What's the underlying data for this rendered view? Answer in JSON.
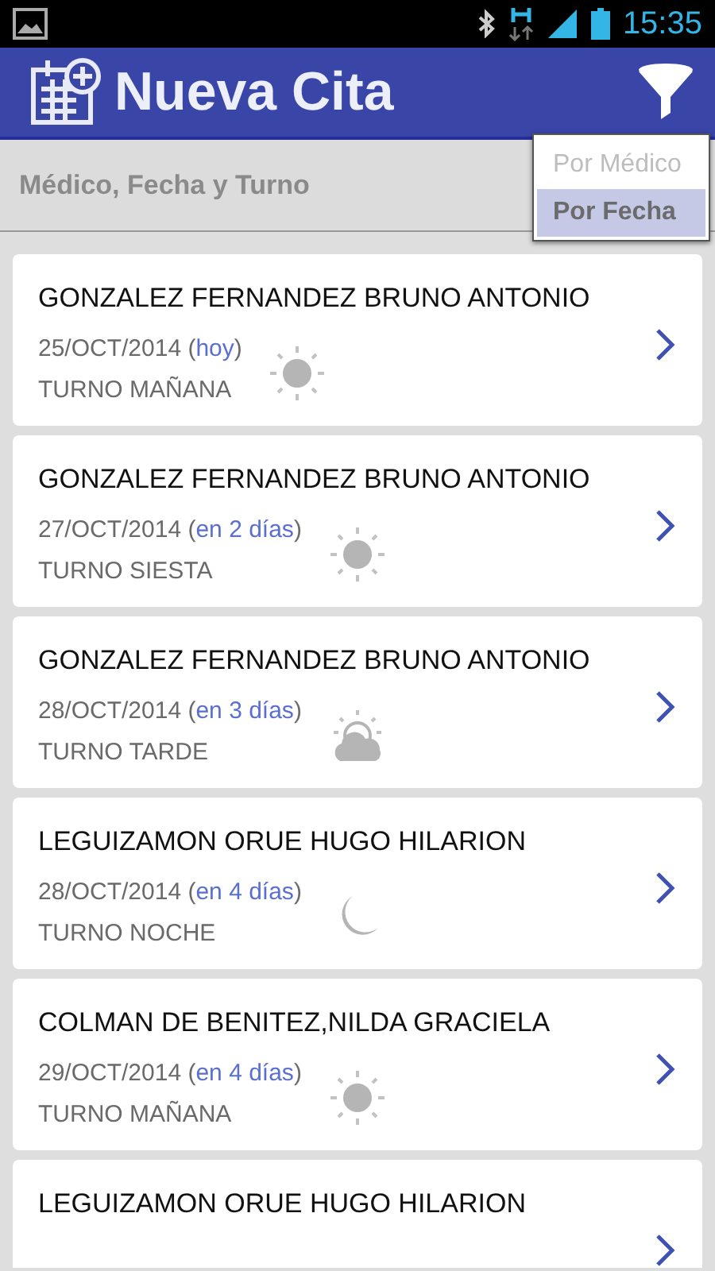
{
  "status_bar": {
    "time": "15:35"
  },
  "app_bar": {
    "title": "Nueva Cita"
  },
  "subheader": {
    "title": "Médico, Fecha y Turno"
  },
  "sort_menu": [
    {
      "label": "Por Médico",
      "selected": false
    },
    {
      "label": "Por Fecha",
      "selected": true
    }
  ],
  "appointments": [
    {
      "name": "GONZALEZ FERNANDEZ BRUNO ANTONIO",
      "date": "25/OCT/2014",
      "open": "(",
      "relative": "hoy",
      "close": ")",
      "shift": "TURNO MAÑANA",
      "kind": "sun"
    },
    {
      "name": "GONZALEZ FERNANDEZ BRUNO ANTONIO",
      "date": "27/OCT/2014",
      "open": "(",
      "relative": "en 2 días",
      "close": ")",
      "shift": "TURNO SIESTA",
      "kind": "sun"
    },
    {
      "name": "GONZALEZ FERNANDEZ BRUNO ANTONIO",
      "date": "28/OCT/2014",
      "open": "(",
      "relative": "en 3 días",
      "close": ")",
      "shift": "TURNO TARDE",
      "kind": "cloud"
    },
    {
      "name": "LEGUIZAMON ORUE HUGO HILARION",
      "date": "28/OCT/2014",
      "open": "(",
      "relative": "en 4 días",
      "close": ")",
      "shift": "TURNO NOCHE",
      "kind": "moon"
    },
    {
      "name": "COLMAN DE BENITEZ,NILDA GRACIELA",
      "date": "29/OCT/2014",
      "open": "(",
      "relative": "en 4 días",
      "close": ")",
      "shift": "TURNO MAÑANA",
      "kind": "sun"
    },
    {
      "name": "LEGUIZAMON ORUE HUGO HILARION"
    }
  ]
}
